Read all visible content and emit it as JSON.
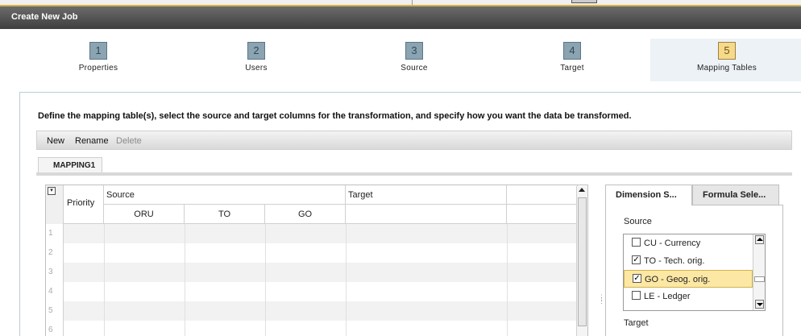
{
  "window": {
    "title": "Create New Job"
  },
  "wizard": {
    "steps": [
      {
        "num": "1",
        "label": "Properties"
      },
      {
        "num": "2",
        "label": "Users"
      },
      {
        "num": "3",
        "label": "Source"
      },
      {
        "num": "4",
        "label": "Target"
      },
      {
        "num": "5",
        "label": "Mapping Tables"
      }
    ],
    "active_step": "5"
  },
  "instructions": "Define the mapping table(s), select the source and target columns for the transformation, and specify how you want the data be transformed.",
  "toolbar": {
    "new_label": "New",
    "rename_label": "Rename",
    "delete_label": "Delete"
  },
  "mapping_tab": "MAPPING1",
  "grid": {
    "header_priority": "Priority",
    "header_source": "Source",
    "header_target": "Target",
    "source_columns": [
      "ORU",
      "TO",
      "GO"
    ],
    "row_numbers": [
      "1",
      "2",
      "3",
      "4",
      "5",
      "6"
    ]
  },
  "side_panel": {
    "tabs": [
      "Dimension S...",
      "Formula Sele..."
    ],
    "source_label": "Source",
    "target_label": "Target",
    "dimensions": [
      {
        "label": "CU - Currency",
        "checked": false,
        "selected": false
      },
      {
        "label": "TO - Tech. orig.",
        "checked": true,
        "selected": false
      },
      {
        "label": "GO - Geog. orig.",
        "checked": true,
        "selected": true
      },
      {
        "label": "LE - Ledger",
        "checked": false,
        "selected": false
      }
    ]
  },
  "colors": {
    "title_bar": "#4f4f4f",
    "step_inactive": "#8ca3b2",
    "step_active": "#f7d98a",
    "selection": "#fce8a4"
  }
}
